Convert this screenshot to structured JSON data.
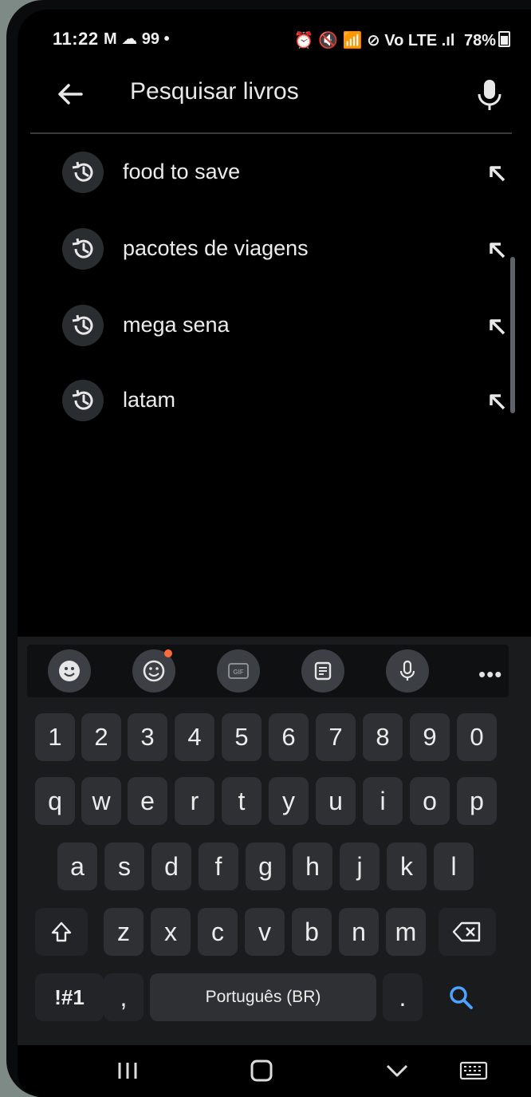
{
  "status_bar": {
    "time": "11:22",
    "left_indicators": "M ☁ 99 •",
    "right_indicators": "⏰ 🔇 📶 ⊘ Vo LTE .ıl",
    "battery": "78%"
  },
  "search": {
    "title": "Pesquisar livros"
  },
  "suggestions": [
    {
      "label": "food to save"
    },
    {
      "label": "pacotes de viagens"
    },
    {
      "label": "mega sena"
    },
    {
      "label": "latam"
    }
  ],
  "keyboard": {
    "toolbar_more": "•••",
    "numbers": [
      "1",
      "2",
      "3",
      "4",
      "5",
      "6",
      "7",
      "8",
      "9",
      "0"
    ],
    "row1": [
      "q",
      "w",
      "e",
      "r",
      "t",
      "y",
      "u",
      "i",
      "o",
      "p"
    ],
    "row2": [
      "a",
      "s",
      "d",
      "f",
      "g",
      "h",
      "j",
      "k",
      "l"
    ],
    "row3": [
      "z",
      "x",
      "c",
      "v",
      "b",
      "n",
      "m"
    ],
    "symbols_label": "!#1",
    "comma": ",",
    "space_label": "Português (BR)",
    "period": ".",
    "accent_color": "#4da3ff"
  },
  "colors": {
    "background": "#000000",
    "key": "#2e3033",
    "text": "#ececec"
  }
}
